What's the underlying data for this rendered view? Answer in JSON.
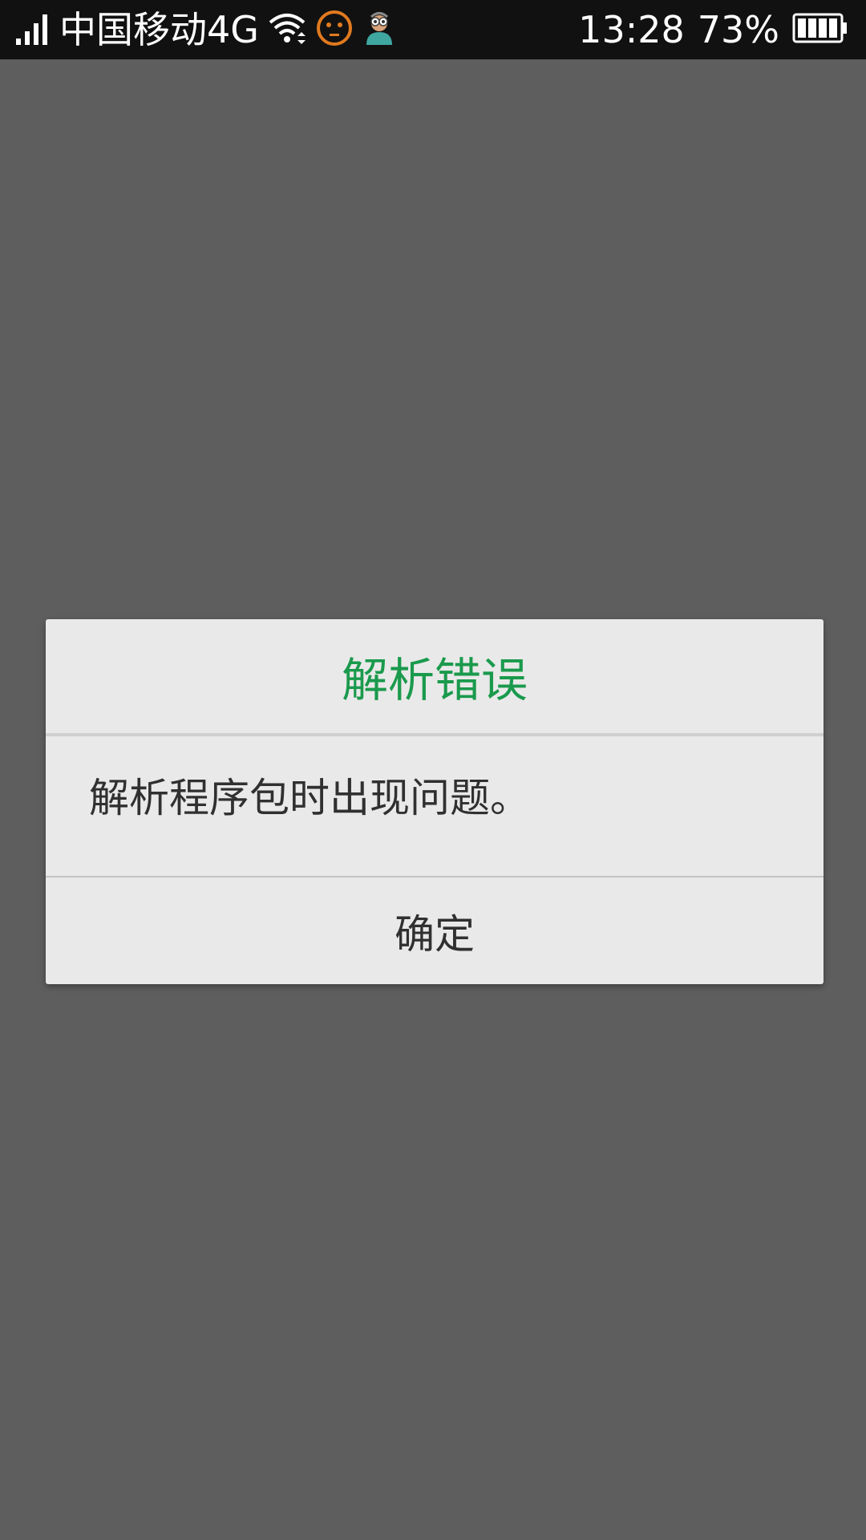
{
  "status_bar": {
    "carrier": "中国移动4G",
    "time": "13:28",
    "battery_percent": "73%",
    "icons": [
      "signal-icon",
      "wifi-icon",
      "face-icon",
      "avatar-icon",
      "battery-icon"
    ],
    "colors": {
      "background": "#111111",
      "face_icon": "#e07a1f"
    }
  },
  "dialog": {
    "title": "解析错误",
    "message": "解析程序包时出现问题。",
    "ok_label": "确定",
    "colors": {
      "title": "#1a9a4c",
      "background": "#e9e9e9",
      "text": "#303030"
    }
  },
  "screen": {
    "background_color": "#5e5e5e"
  }
}
